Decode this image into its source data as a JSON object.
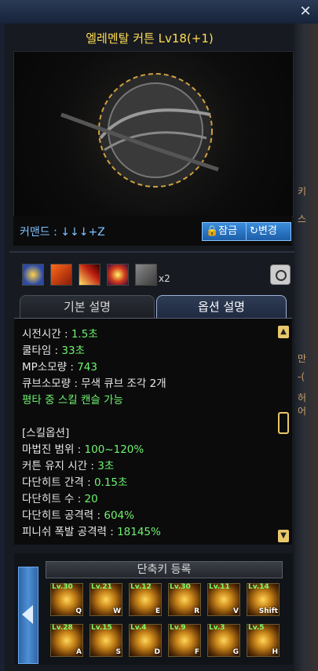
{
  "window": {
    "close_icon": "close-icon"
  },
  "skill": {
    "title": "엘레멘탈 커튼 Lv18(+1)",
    "command_label": "커맨드 : ↓↓↓+Z",
    "lock_label": "🔒잠금",
    "change_label": "↻변경"
  },
  "runes": {
    "count_label": "x2"
  },
  "tabs": [
    {
      "label": "기본 설명",
      "active": false
    },
    {
      "label": "옵션 설명",
      "active": true
    }
  ],
  "details": {
    "cast_time": {
      "label": "시전시간 : ",
      "value": "1.5초"
    },
    "cooldown": {
      "label": "쿨타임 : ",
      "value": "33초"
    },
    "mp_cost": {
      "label": "MP소모량 : ",
      "value": "743"
    },
    "cube_cost": "큐브소모량 : 무색 큐브 조각 2개",
    "cancel_note": "평타 중 스킬 캔슬 가능",
    "section_header": "[스킬옵션]",
    "options": [
      {
        "label": "마법진 범위 : ",
        "value": "100~120%"
      },
      {
        "label": "커튼 유지 시간 : ",
        "value": "3초"
      },
      {
        "label": "다단히트 간격 : ",
        "value": "0.15초"
      },
      {
        "label": "다단히트 수 : ",
        "value": "20"
      },
      {
        "label": "다단히트 공격력 : ",
        "value": "604%"
      },
      {
        "label": "피니쉬 폭발 공격력 : ",
        "value": "18145%"
      }
    ]
  },
  "hotkeys": {
    "title": "단축키 등록",
    "row1": [
      {
        "level": "Lv.30",
        "key": "Q"
      },
      {
        "level": "Lv.21",
        "key": "W"
      },
      {
        "level": "Lv.12",
        "key": "E"
      },
      {
        "level": "Lv.30",
        "key": "R"
      },
      {
        "level": "Lv.11",
        "key": "V"
      },
      {
        "level": "Lv.14",
        "key": "Shift"
      }
    ],
    "row2": [
      {
        "level": "Lv.28",
        "key": "A"
      },
      {
        "level": "Lv.15",
        "key": "S"
      },
      {
        "level": "Lv.4",
        "key": "D"
      },
      {
        "level": "Lv.9",
        "key": "F"
      },
      {
        "level": "Lv.3",
        "key": "G"
      },
      {
        "level": "Lv.5",
        "key": "H"
      }
    ]
  },
  "background_fragments": [
    "키",
    "스",
    "만",
    "-(",
    "허어"
  ],
  "colors": {
    "title": "#ffdd55",
    "value_green": "#6ff36f",
    "command_blue": "#7fc3ff",
    "button_blue": "#2d76c6",
    "skill_level_green": "#7eff6a"
  }
}
